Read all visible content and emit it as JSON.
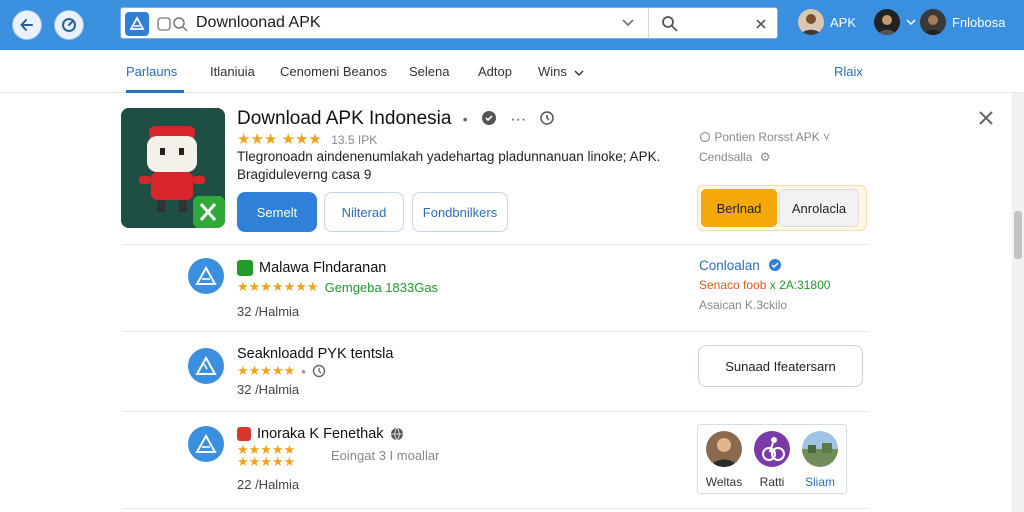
{
  "browser": {
    "search_value": "Downloonad APK",
    "users": [
      {
        "name": "APK"
      },
      {
        "name": "Fnlobosa"
      }
    ]
  },
  "nav": {
    "items": [
      "Parlauns",
      "Itlaniuia",
      "Cenomeni Beanos",
      "Selena",
      "Adtop",
      "Wins"
    ],
    "right": "Rlaix"
  },
  "app": {
    "title": "Download APK Indonesia",
    "rating_text": "13.5 IPK",
    "description": "Tlegronoadn aindenenumlakah yadehartag pladunnanuan linoke; APK. Bragiduleverng casa 9",
    "buttons": {
      "primary": "Semelt",
      "second": "Nilterad",
      "third": "Fondbnilkers"
    },
    "right_meta": {
      "line1": "Pontien Rorsst APK",
      "line2": "Cendsalla"
    },
    "download": {
      "left": "Berlnad",
      "right": "Anrolacla"
    }
  },
  "rows": [
    {
      "title": "Malawa Flndaranan",
      "rating_text": "Gemgeba 1833Gas",
      "size": "32 /Halmia",
      "side": {
        "name": "Conloalan",
        "line1_a": "Senaco foob",
        "line1_b": "x 2A:31800",
        "line2": "Asaican K.3ckilo"
      }
    },
    {
      "title": "Seaknloadd PYK tentsla",
      "size": "32 /Halmia",
      "button": "Sunaad Ifeatersarn"
    },
    {
      "title": "Inoraka K Fenethak",
      "rating_text": "Eoingat 3 I moallar",
      "size": "22 /Halmia",
      "friends": [
        "Weltas",
        "Ratti",
        "Sliam"
      ]
    }
  ],
  "colors": {
    "accent": "#3b8fdf",
    "star": "#f1a21a",
    "download": "#f5a80a",
    "green": "#1f9b2a"
  }
}
